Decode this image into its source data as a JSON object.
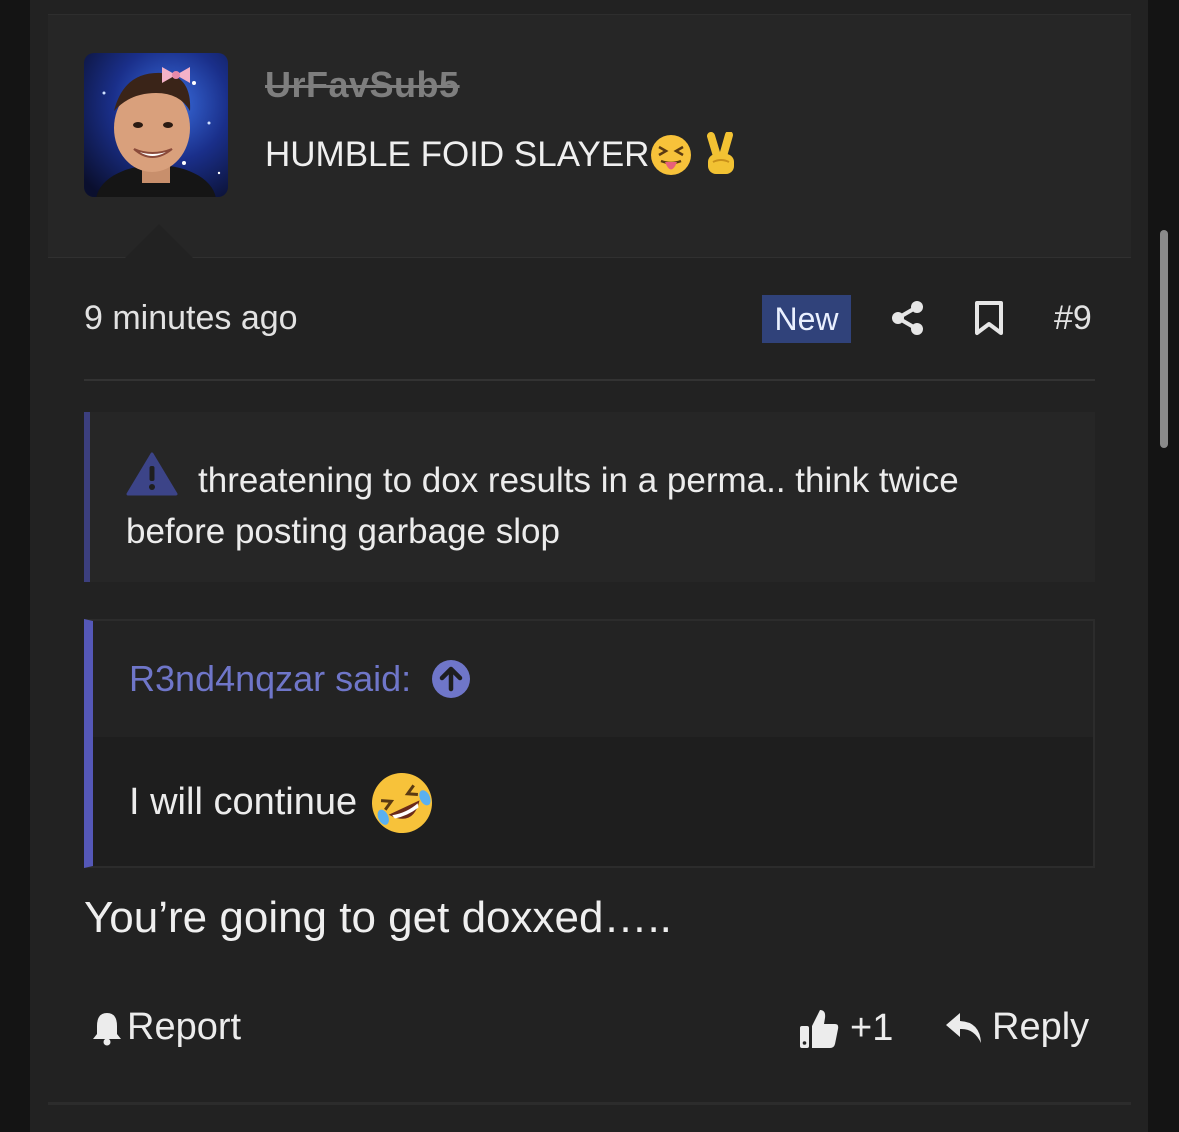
{
  "colors": {
    "page_bg": "#141414",
    "card_bg": "#222222",
    "header_bg": "#262626",
    "new_badge": "#30427a",
    "quote_accent": "#5558b8",
    "notice_accent": "#3c3f7e",
    "quote_link": "#6f76c9"
  },
  "user": {
    "name": "UrFavSub5",
    "title": "HUMBLE FOID SLAYER",
    "title_emojis": [
      "squinting-tongue-emoji",
      "victory-hand-emoji"
    ],
    "avatar": "avatar-photo-with-pink-bow"
  },
  "meta": {
    "time": "9 minutes ago",
    "badge": "New",
    "post_number": "#9",
    "icons": [
      "share-icon",
      "bookmark-icon"
    ]
  },
  "notice": {
    "icon": "warning-triangle-icon",
    "text": "threatening to dox results in a perma.. think twice before posting garbage slop"
  },
  "quote": {
    "author_line": "R3nd4nqzar said:",
    "icon": "arrow-up-circle-icon",
    "text": "I will continue",
    "emoji": "rolling-on-floor-laughing-emoji"
  },
  "post": {
    "body": "You’re going to get doxxed….."
  },
  "actions": {
    "report_label": "Report",
    "like_label": "+1",
    "reply_label": "Reply"
  }
}
